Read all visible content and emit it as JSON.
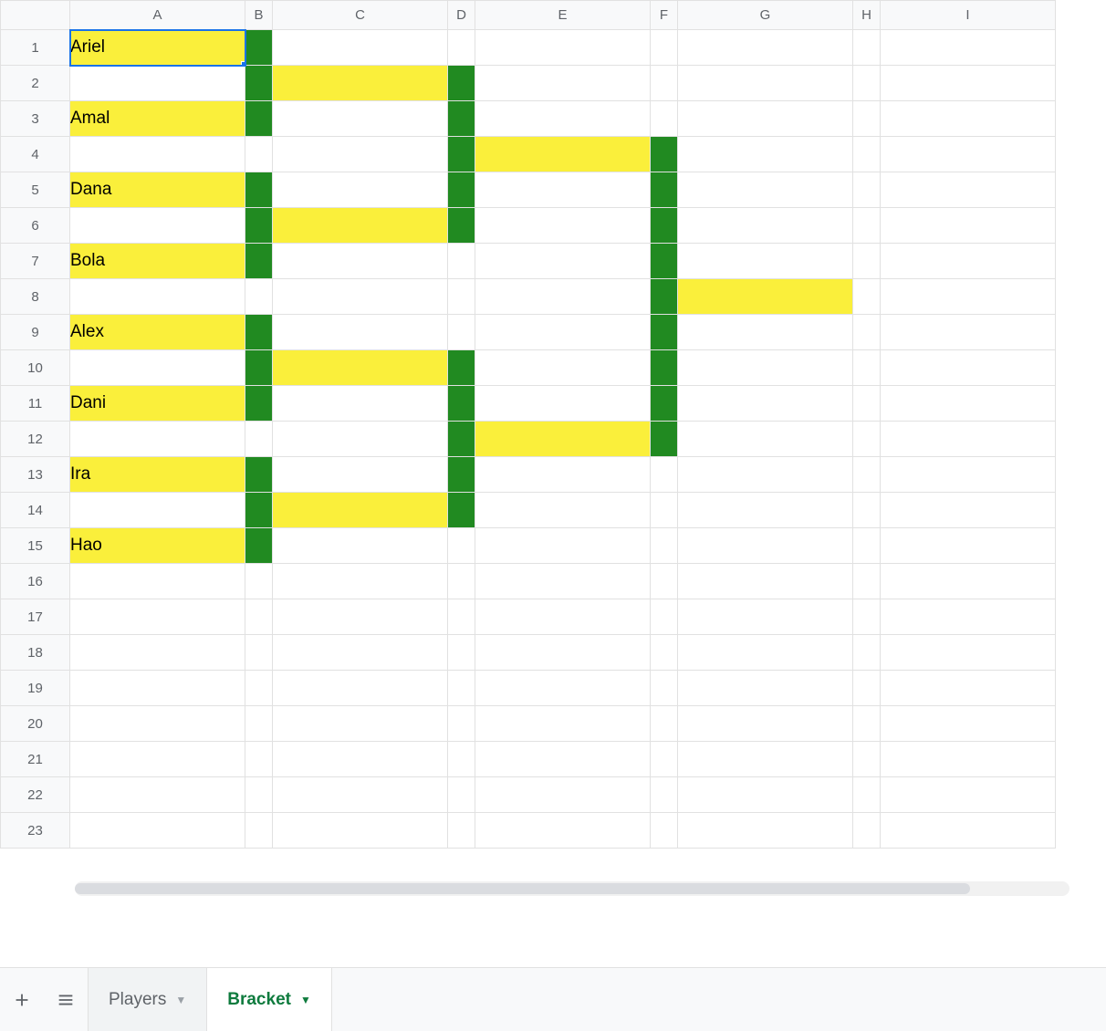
{
  "columns": [
    "A",
    "B",
    "C",
    "D",
    "E",
    "F",
    "G",
    "H",
    "I"
  ],
  "row_count": 23,
  "selected_cell": "A1",
  "cells": {
    "A1": {
      "text": "Ariel",
      "bg": "yellow"
    },
    "B1": {
      "bg": "green"
    },
    "B2": {
      "bg": "green"
    },
    "C2": {
      "bg": "yellow"
    },
    "D2": {
      "bg": "green"
    },
    "A3": {
      "text": "Amal",
      "bg": "yellow"
    },
    "B3": {
      "bg": "green"
    },
    "D3": {
      "bg": "green"
    },
    "D4": {
      "bg": "green"
    },
    "E4": {
      "bg": "yellow"
    },
    "F4": {
      "bg": "green"
    },
    "A5": {
      "text": "Dana",
      "bg": "yellow"
    },
    "B5": {
      "bg": "green"
    },
    "D5": {
      "bg": "green"
    },
    "F5": {
      "bg": "green"
    },
    "B6": {
      "bg": "green"
    },
    "C6": {
      "bg": "yellow"
    },
    "D6": {
      "bg": "green"
    },
    "F6": {
      "bg": "green"
    },
    "A7": {
      "text": "Bola",
      "bg": "yellow"
    },
    "B7": {
      "bg": "green"
    },
    "F7": {
      "bg": "green"
    },
    "F8": {
      "bg": "green"
    },
    "G8": {
      "bg": "yellow"
    },
    "A9": {
      "text": "Alex",
      "bg": "yellow"
    },
    "B9": {
      "bg": "green"
    },
    "F9": {
      "bg": "green"
    },
    "B10": {
      "bg": "green"
    },
    "C10": {
      "bg": "yellow"
    },
    "D10": {
      "bg": "green"
    },
    "F10": {
      "bg": "green"
    },
    "A11": {
      "text": "Dani",
      "bg": "yellow"
    },
    "B11": {
      "bg": "green"
    },
    "D11": {
      "bg": "green"
    },
    "F11": {
      "bg": "green"
    },
    "D12": {
      "bg": "green"
    },
    "E12": {
      "bg": "yellow"
    },
    "F12": {
      "bg": "green"
    },
    "A13": {
      "text": "Ira",
      "bg": "yellow"
    },
    "B13": {
      "bg": "green"
    },
    "D13": {
      "bg": "green"
    },
    "B14": {
      "bg": "green"
    },
    "C14": {
      "bg": "yellow"
    },
    "D14": {
      "bg": "green"
    },
    "A15": {
      "text": "Hao",
      "bg": "yellow"
    },
    "B15": {
      "bg": "green"
    }
  },
  "tabs": [
    {
      "label": "Players",
      "active": false
    },
    {
      "label": "Bracket",
      "active": true
    }
  ]
}
